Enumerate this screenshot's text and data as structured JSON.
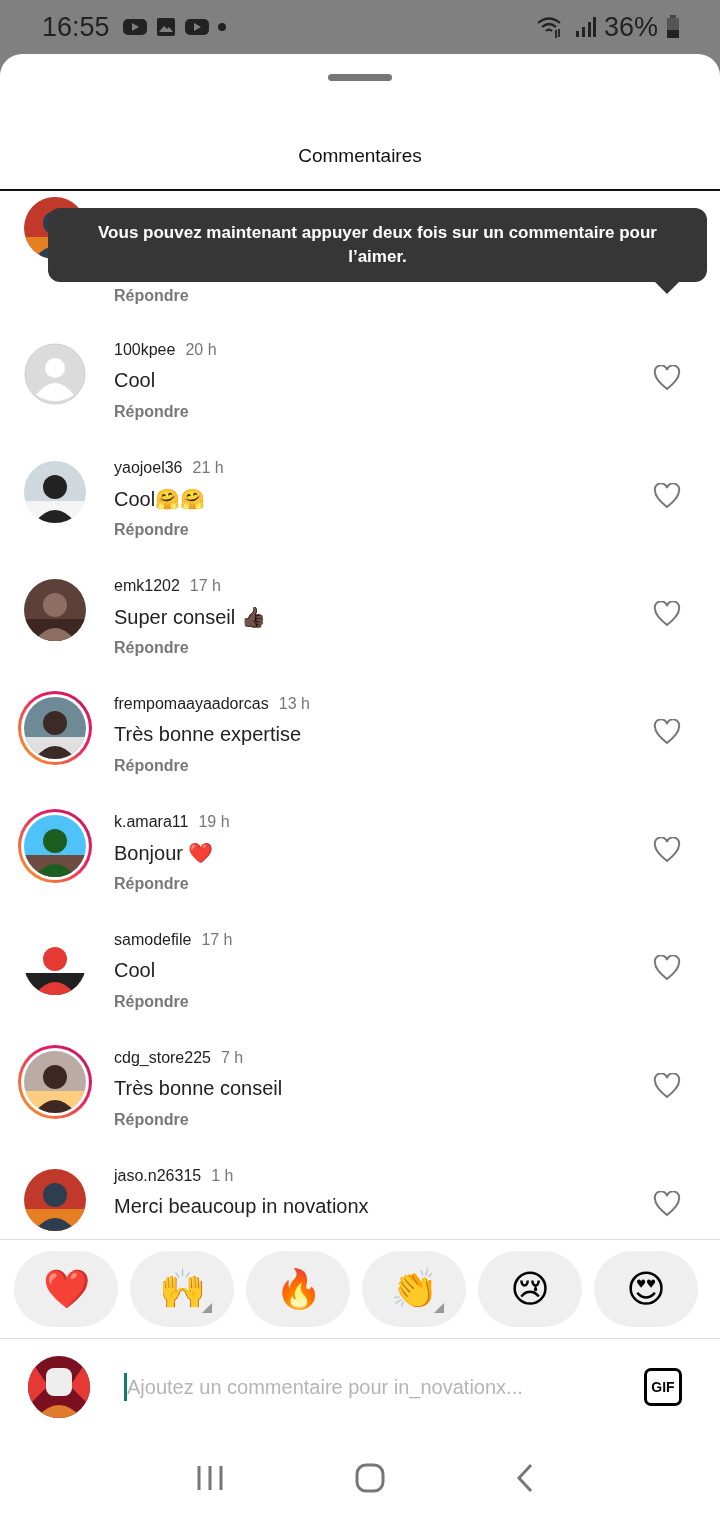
{
  "status_bar": {
    "time": "16:55",
    "battery": "36%"
  },
  "sheet": {
    "title": "Commentaires"
  },
  "tooltip": {
    "text": "Vous pouvez maintenant appuyer deux fois sur un commentaire pour l’aimer."
  },
  "comments": [
    {
      "story_ring": false,
      "reply": "Répondre"
    },
    {
      "avatar": {
        "kind": "default"
      },
      "story_ring": false,
      "username": "100kpee",
      "time": "20 h",
      "text": "Cool",
      "reply": "Répondre"
    },
    {
      "story_ring": false,
      "username": "yaojoel36",
      "time": "21 h",
      "text": "Cool🤗🤗",
      "reply": "Répondre"
    },
    {
      "story_ring": false,
      "username": "emk1202",
      "time": "17 h",
      "text": "Super conseil 👍🏿",
      "reply": "Répondre"
    },
    {
      "story_ring": true,
      "username": "frempomaayaadorcas",
      "time": "13 h",
      "text": "Très bonne expertise",
      "reply": "Répondre"
    },
    {
      "story_ring": true,
      "username": "k.amara11",
      "time": "19 h",
      "text": "Bonjour ❤️",
      "reply": "Répondre"
    },
    {
      "story_ring": false,
      "username": "samodefile",
      "time": "17 h",
      "text": "Cool",
      "reply": "Répondre"
    },
    {
      "story_ring": true,
      "username": "cdg_store225",
      "time": "7 h",
      "text": "Très bonne conseil",
      "reply": "Répondre"
    },
    {
      "story_ring": false,
      "username": "jaso.n26315",
      "time": "1 h",
      "text": "Merci beaucoup in novationx"
    }
  ],
  "reactions": [
    {
      "emoji": "❤️",
      "has_variants": false
    },
    {
      "emoji": "🙌",
      "has_variants": true
    },
    {
      "emoji": "🔥",
      "has_variants": false
    },
    {
      "emoji": "👏",
      "has_variants": true
    },
    {
      "emoji": "😢",
      "has_variants": false
    },
    {
      "emoji": "😍",
      "has_variants": false
    }
  ],
  "composer": {
    "placeholder": "Ajoutez un commentaire pour in_novationx...",
    "gif": "GIF"
  }
}
